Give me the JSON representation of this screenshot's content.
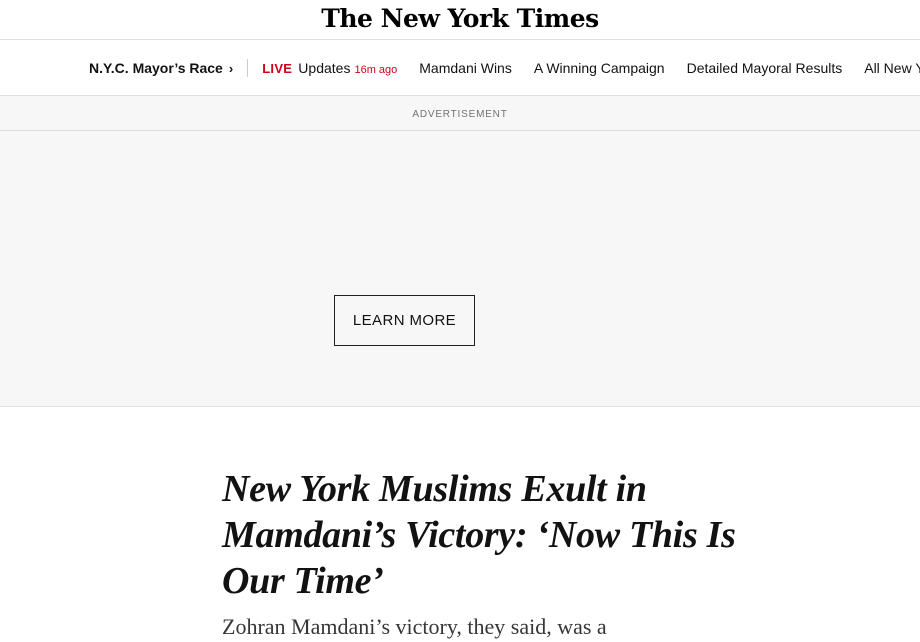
{
  "masthead": {
    "logo_text": "The New York Times"
  },
  "section_nav": {
    "section_title": "N.Y.C. Mayor’s Race",
    "chevron": "›",
    "live": {
      "badge": "LIVE",
      "text": "Updates",
      "time": "16m ago"
    },
    "items": [
      {
        "label": "Mamdani Wins"
      },
      {
        "label": "A Winning Campaign"
      },
      {
        "label": "Detailed Mayoral Results"
      },
      {
        "label": "All New York R"
      }
    ]
  },
  "ad": {
    "label": "ADVERTISEMENT",
    "button_label": "LEARN MORE"
  },
  "article": {
    "headline": "New York Muslims Exult in Mamdani’s Victory: ‘Now This Is Our Time’",
    "summary_partial": "Zohran Mamdani’s victory, they said, was a"
  },
  "colors": {
    "live_red": "#d0021b",
    "ad_background": "#f7f7f7",
    "text_primary": "#121212"
  }
}
